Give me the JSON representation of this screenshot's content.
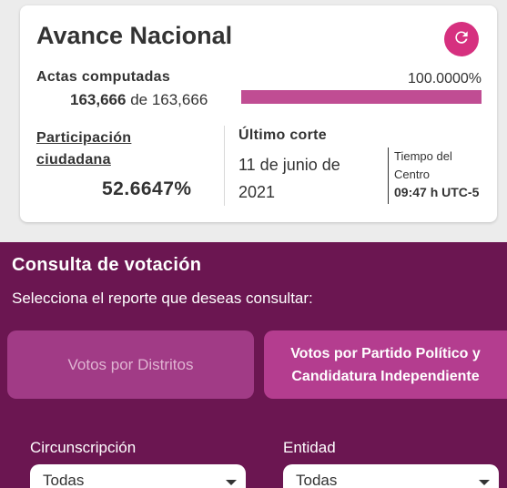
{
  "avance": {
    "title": "Avance Nacional",
    "actas_label": "Actas computadas",
    "actas_computed": "163,666",
    "actas_of": "de 163,666",
    "percent_text": "100.0000%",
    "progress_fraction": 1.0,
    "participacion_label": "Participación ciudadana",
    "participacion_value": "52.6647%",
    "ultimo_corte_label": "Último corte",
    "ultimo_corte_date": "11 de junio de 2021",
    "tz_label": "Tiempo del Centro",
    "tz_time": "09:47 h UTC-5"
  },
  "consulta": {
    "title": "Consulta de votación",
    "subtitle": "Selecciona el reporte que deseas consultar:",
    "buttons": [
      {
        "label": "Votos por Distritos"
      },
      {
        "label": "Votos por Partido Político y Candidatura Independiente"
      }
    ],
    "filters": [
      {
        "label": "Circunscripción",
        "value": "Todas"
      },
      {
        "label": "Entidad",
        "value": "Todas"
      }
    ]
  },
  "colors": {
    "accent": "#d6307f",
    "progress": "#c04d93",
    "panel": "#6b1651"
  },
  "icons": {
    "refresh": "refresh-icon"
  }
}
